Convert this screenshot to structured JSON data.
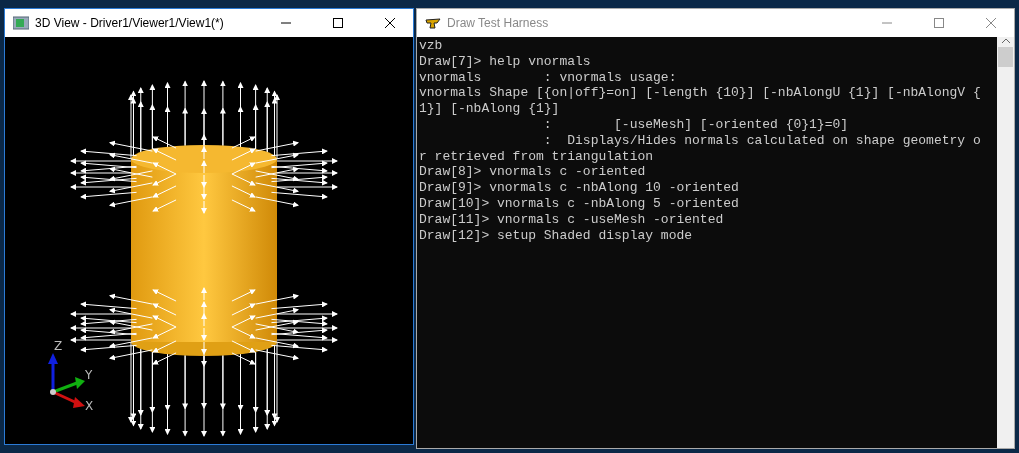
{
  "windows": [
    {
      "kind": "viewer",
      "title": "3D View - Driver1/Viewer1/View1(*)",
      "active": true,
      "axes": {
        "x": "X",
        "y": "Y",
        "z": "Z"
      }
    },
    {
      "kind": "console",
      "title": "Draw Test Harness",
      "active": false,
      "lines": [
        "vzb",
        "Draw[7]> help vnormals",
        "vnormals        : vnormals usage:",
        "vnormals Shape [{on|off}=on] [-length {10}] [-nbAlongU {1}] [-nbAlongV {",
        "1}] [-nbAlong {1}]",
        "                :        [-useMesh] [-oriented {0}1}=0]",
        "                :  Displays/Hides normals calculated on shape geometry o",
        "r retrieved from triangulation",
        "Draw[8]> vnormals c -oriented",
        "Draw[9]> vnormals c -nbAlong 10 -oriented",
        "Draw[10]> vnormals c -nbAlong 5 -oriented",
        "Draw[11]> vnormals c -useMesh -oriented",
        "Draw[12]> setup Shaded display mode"
      ]
    }
  ]
}
